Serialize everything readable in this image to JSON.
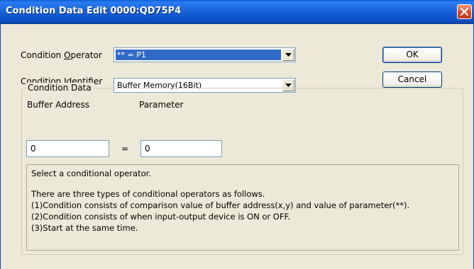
{
  "window": {
    "title": "Condition Data Edit 0000:QD75P4"
  },
  "form": {
    "operator_label_pre": "Condition ",
    "operator_label_key": "O",
    "operator_label_post": "perator",
    "operator_value": "** = P1",
    "identifier_label_pre": "Condition ",
    "identifier_label_key": "I",
    "identifier_label_post": "dentifier",
    "identifier_value": "Buffer Memory(16Bit)"
  },
  "buttons": {
    "ok": "OK",
    "cancel": "Cancel"
  },
  "condition_data": {
    "caption": "Condition Data",
    "buffer_address_label": "Buffer Address",
    "parameter_label": "Parameter",
    "buffer_address_value": "0",
    "equals": "=",
    "parameter_value": "0"
  },
  "info": {
    "lines": [
      "Select a conditional operator.",
      "There are three types of conditional operators as follows.",
      "(1)Condition consists of comparison value of buffer address(x,y) and value of parameter(**).",
      "(2)Condition consists of when input-output device is ON or OFF.",
      "(3)Start at the same time."
    ]
  }
}
